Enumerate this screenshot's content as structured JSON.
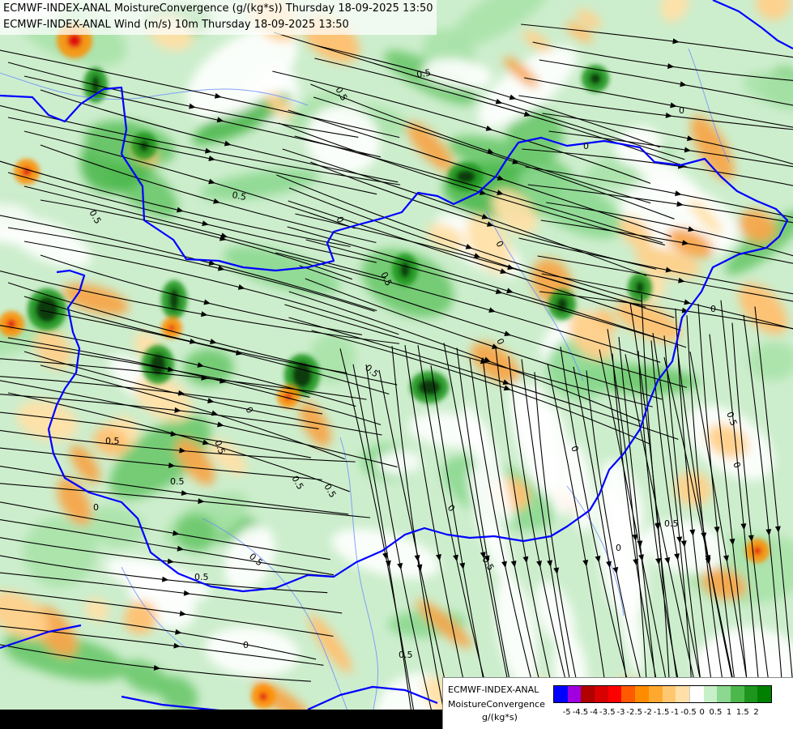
{
  "titles": {
    "line1": "ECMWF-INDEX-ANAL MoistureConvergence (g/(kg*s)) Thursday 18-09-2025 13:50",
    "line2": "ECMWF-INDEX-ANAL Wind (m/s) 10m Thursday 18-09-2025 13:50"
  },
  "legend": {
    "title_line1": "ECMWF-INDEX-ANAL",
    "title_line2": "MoistureConvergence",
    "unit": "g/(kg*s)",
    "ticks": [
      "-5",
      "-4.5",
      "-4",
      "-3.5",
      "-3",
      "-2.5",
      "-2",
      "-1.5",
      "-1",
      "-0.5",
      "0",
      "0.5",
      "1",
      "1.5",
      "2"
    ],
    "colors": [
      "#0000ff",
      "#a000e0",
      "#b00000",
      "#d80000",
      "#ff0000",
      "#ff5a00",
      "#ff8c00",
      "#ffa830",
      "#ffc870",
      "#ffe0a8",
      "#ffffff",
      "#c8f0c8",
      "#8cd890",
      "#4cb84c",
      "#1e961e",
      "#008000"
    ]
  },
  "map": {
    "contour_labels": [
      "0.5",
      "0.5",
      "0.5",
      "0.5",
      "0.5",
      "0",
      "0",
      "0",
      "0",
      "0",
      "0.5",
      "0",
      "0.5",
      "0.5",
      "0",
      "0.5",
      "0",
      "0.5",
      "0.5",
      "0",
      "0.5",
      "0.5",
      "0",
      "0.5",
      "0",
      "0.5",
      "0",
      "0.5",
      "0",
      "0.5"
    ],
    "border_color": "#0000ff",
    "river_color": "#6a8cff",
    "streamline_color": "#000000"
  }
}
